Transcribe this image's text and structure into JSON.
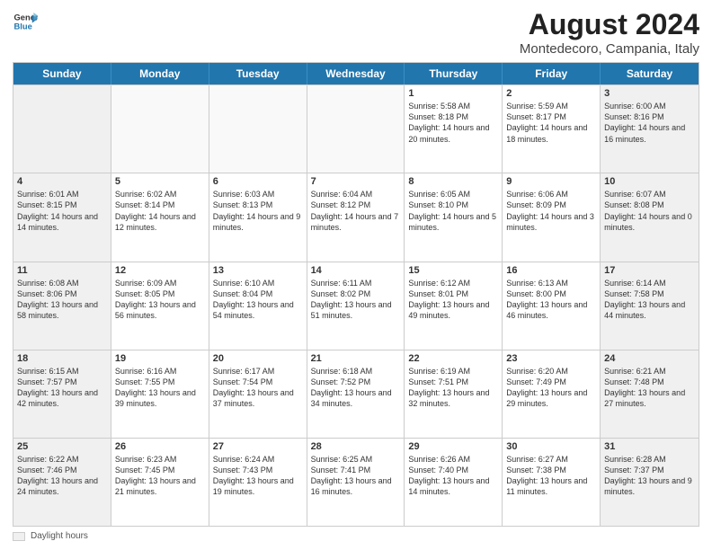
{
  "header": {
    "logo_line1": "General",
    "logo_line2": "Blue",
    "main_title": "August 2024",
    "subtitle": "Montedecoro, Campania, Italy"
  },
  "days_of_week": [
    "Sunday",
    "Monday",
    "Tuesday",
    "Wednesday",
    "Thursday",
    "Friday",
    "Saturday"
  ],
  "weeks": [
    [
      {
        "day": "",
        "text": ""
      },
      {
        "day": "",
        "text": ""
      },
      {
        "day": "",
        "text": ""
      },
      {
        "day": "",
        "text": ""
      },
      {
        "day": "1",
        "text": "Sunrise: 5:58 AM\nSunset: 8:18 PM\nDaylight: 14 hours and 20 minutes."
      },
      {
        "day": "2",
        "text": "Sunrise: 5:59 AM\nSunset: 8:17 PM\nDaylight: 14 hours and 18 minutes."
      },
      {
        "day": "3",
        "text": "Sunrise: 6:00 AM\nSunset: 8:16 PM\nDaylight: 14 hours and 16 minutes."
      }
    ],
    [
      {
        "day": "4",
        "text": "Sunrise: 6:01 AM\nSunset: 8:15 PM\nDaylight: 14 hours and 14 minutes."
      },
      {
        "day": "5",
        "text": "Sunrise: 6:02 AM\nSunset: 8:14 PM\nDaylight: 14 hours and 12 minutes."
      },
      {
        "day": "6",
        "text": "Sunrise: 6:03 AM\nSunset: 8:13 PM\nDaylight: 14 hours and 9 minutes."
      },
      {
        "day": "7",
        "text": "Sunrise: 6:04 AM\nSunset: 8:12 PM\nDaylight: 14 hours and 7 minutes."
      },
      {
        "day": "8",
        "text": "Sunrise: 6:05 AM\nSunset: 8:10 PM\nDaylight: 14 hours and 5 minutes."
      },
      {
        "day": "9",
        "text": "Sunrise: 6:06 AM\nSunset: 8:09 PM\nDaylight: 14 hours and 3 minutes."
      },
      {
        "day": "10",
        "text": "Sunrise: 6:07 AM\nSunset: 8:08 PM\nDaylight: 14 hours and 0 minutes."
      }
    ],
    [
      {
        "day": "11",
        "text": "Sunrise: 6:08 AM\nSunset: 8:06 PM\nDaylight: 13 hours and 58 minutes."
      },
      {
        "day": "12",
        "text": "Sunrise: 6:09 AM\nSunset: 8:05 PM\nDaylight: 13 hours and 56 minutes."
      },
      {
        "day": "13",
        "text": "Sunrise: 6:10 AM\nSunset: 8:04 PM\nDaylight: 13 hours and 54 minutes."
      },
      {
        "day": "14",
        "text": "Sunrise: 6:11 AM\nSunset: 8:02 PM\nDaylight: 13 hours and 51 minutes."
      },
      {
        "day": "15",
        "text": "Sunrise: 6:12 AM\nSunset: 8:01 PM\nDaylight: 13 hours and 49 minutes."
      },
      {
        "day": "16",
        "text": "Sunrise: 6:13 AM\nSunset: 8:00 PM\nDaylight: 13 hours and 46 minutes."
      },
      {
        "day": "17",
        "text": "Sunrise: 6:14 AM\nSunset: 7:58 PM\nDaylight: 13 hours and 44 minutes."
      }
    ],
    [
      {
        "day": "18",
        "text": "Sunrise: 6:15 AM\nSunset: 7:57 PM\nDaylight: 13 hours and 42 minutes."
      },
      {
        "day": "19",
        "text": "Sunrise: 6:16 AM\nSunset: 7:55 PM\nDaylight: 13 hours and 39 minutes."
      },
      {
        "day": "20",
        "text": "Sunrise: 6:17 AM\nSunset: 7:54 PM\nDaylight: 13 hours and 37 minutes."
      },
      {
        "day": "21",
        "text": "Sunrise: 6:18 AM\nSunset: 7:52 PM\nDaylight: 13 hours and 34 minutes."
      },
      {
        "day": "22",
        "text": "Sunrise: 6:19 AM\nSunset: 7:51 PM\nDaylight: 13 hours and 32 minutes."
      },
      {
        "day": "23",
        "text": "Sunrise: 6:20 AM\nSunset: 7:49 PM\nDaylight: 13 hours and 29 minutes."
      },
      {
        "day": "24",
        "text": "Sunrise: 6:21 AM\nSunset: 7:48 PM\nDaylight: 13 hours and 27 minutes."
      }
    ],
    [
      {
        "day": "25",
        "text": "Sunrise: 6:22 AM\nSunset: 7:46 PM\nDaylight: 13 hours and 24 minutes."
      },
      {
        "day": "26",
        "text": "Sunrise: 6:23 AM\nSunset: 7:45 PM\nDaylight: 13 hours and 21 minutes."
      },
      {
        "day": "27",
        "text": "Sunrise: 6:24 AM\nSunset: 7:43 PM\nDaylight: 13 hours and 19 minutes."
      },
      {
        "day": "28",
        "text": "Sunrise: 6:25 AM\nSunset: 7:41 PM\nDaylight: 13 hours and 16 minutes."
      },
      {
        "day": "29",
        "text": "Sunrise: 6:26 AM\nSunset: 7:40 PM\nDaylight: 13 hours and 14 minutes."
      },
      {
        "day": "30",
        "text": "Sunrise: 6:27 AM\nSunset: 7:38 PM\nDaylight: 13 hours and 11 minutes."
      },
      {
        "day": "31",
        "text": "Sunrise: 6:28 AM\nSunset: 7:37 PM\nDaylight: 13 hours and 9 minutes."
      }
    ]
  ],
  "footer": {
    "daylight_label": "Daylight hours"
  }
}
